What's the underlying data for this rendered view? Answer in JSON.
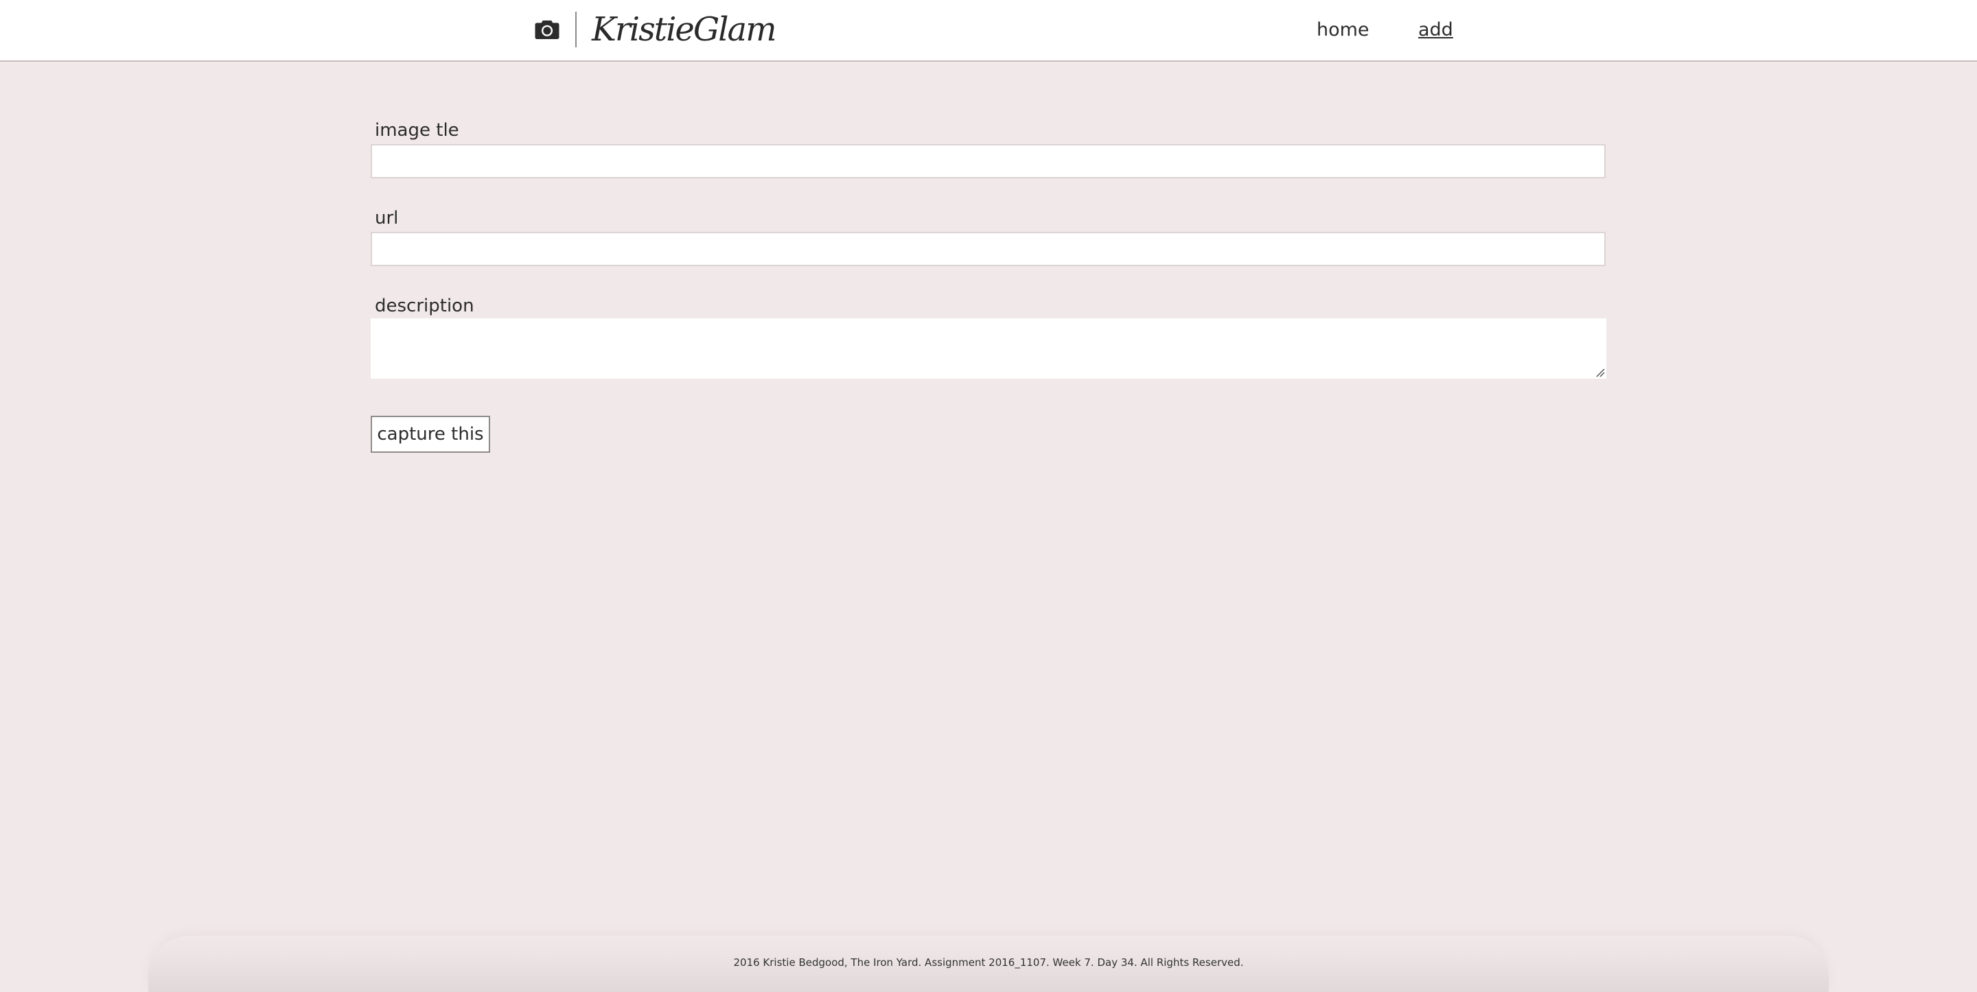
{
  "header": {
    "logo_icon": "camera-icon",
    "brand": "KristieGlam",
    "nav": [
      {
        "label": "home",
        "active": false
      },
      {
        "label": "add",
        "active": true
      }
    ]
  },
  "form": {
    "image_title": {
      "label": "image tle",
      "value": "",
      "placeholder": ""
    },
    "url": {
      "label": "url",
      "value": "",
      "placeholder": ""
    },
    "description": {
      "label": "description",
      "value": "",
      "placeholder": ""
    },
    "submit_label": "capture this"
  },
  "footer": {
    "text": "2016 Kristie Bedgood, The Iron Yard. Assignment 2016_1107. Week 7. Day 34. All Rights Reserved."
  },
  "colors": {
    "background": "#f1e8e9",
    "header_bg": "#ffffff",
    "text": "#2c2c2c",
    "input_bg": "#ffffff"
  }
}
